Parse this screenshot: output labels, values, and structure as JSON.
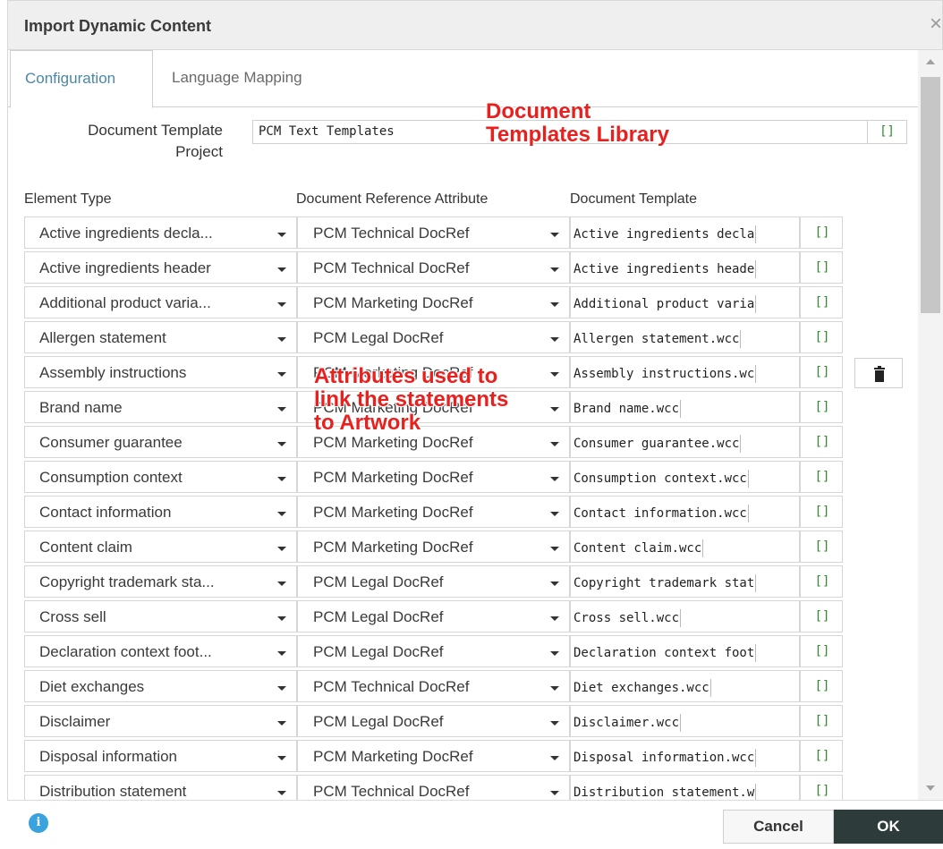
{
  "window": {
    "title": "Import Dynamic Content",
    "close_glyph": "×"
  },
  "tabs": [
    {
      "label": "Configuration",
      "active": true
    },
    {
      "label": "Language Mapping",
      "active": false
    }
  ],
  "project": {
    "label_line1": "Document Template",
    "label_line2": "Project",
    "value": "PCM Text Templates",
    "picker": "[]"
  },
  "columns": {
    "element_type": "Element Type",
    "reference_attribute": "Document Reference Attribute",
    "template": "Document Template"
  },
  "rows": [
    {
      "element": "Active ingredients decla...",
      "attribute": "PCM Technical DocRef",
      "template": "Active ingredients decla",
      "picker": "[]"
    },
    {
      "element": "Active ingredients header",
      "attribute": "PCM Technical DocRef",
      "template": "Active ingredients heade",
      "picker": "[]"
    },
    {
      "element": "Additional product varia...",
      "attribute": "PCM Marketing DocRef",
      "template": "Additional product varia",
      "picker": "[]"
    },
    {
      "element": "Allergen statement",
      "attribute": "PCM Legal DocRef",
      "template": "Allergen statement.wcc",
      "picker": "[]"
    },
    {
      "element": "Assembly instructions",
      "attribute": "PCM Marketing DocRef",
      "template": "Assembly instructions.wc",
      "picker": "[]"
    },
    {
      "element": "Brand name",
      "attribute": "PCM Marketing DocRef",
      "template": "Brand name.wcc",
      "picker": "[]"
    },
    {
      "element": "Consumer guarantee",
      "attribute": "PCM Marketing DocRef",
      "template": "Consumer guarantee.wcc",
      "picker": "[]"
    },
    {
      "element": "Consumption context",
      "attribute": "PCM Marketing DocRef",
      "template": "Consumption context.wcc",
      "picker": "[]"
    },
    {
      "element": "Contact information",
      "attribute": "PCM Marketing DocRef",
      "template": "Contact information.wcc",
      "picker": "[]"
    },
    {
      "element": "Content claim",
      "attribute": "PCM Marketing DocRef",
      "template": "Content claim.wcc",
      "picker": "[]"
    },
    {
      "element": "Copyright trademark sta...",
      "attribute": "PCM Legal DocRef",
      "template": "Copyright trademark stat",
      "picker": "[]"
    },
    {
      "element": "Cross sell",
      "attribute": "PCM Legal DocRef",
      "template": "Cross sell.wcc",
      "picker": "[]"
    },
    {
      "element": "Declaration context foot...",
      "attribute": "PCM Legal DocRef",
      "template": "Declaration context foot",
      "picker": "[]"
    },
    {
      "element": "Diet exchanges",
      "attribute": "PCM Technical DocRef",
      "template": "Diet exchanges.wcc",
      "picker": "[]"
    },
    {
      "element": "Disclaimer",
      "attribute": "PCM Legal DocRef",
      "template": "Disclaimer.wcc",
      "picker": "[]"
    },
    {
      "element": "Disposal information",
      "attribute": "PCM Marketing DocRef",
      "template": "Disposal information.wcc",
      "picker": "[]"
    },
    {
      "element": "Distribution statement",
      "attribute": "PCM Technical DocRef",
      "template": "Distribution statement.w",
      "picker": "[]"
    }
  ],
  "annotations": {
    "library_line1": "Document",
    "library_line2": "Templates Library",
    "attributes_line1": "Attributes used to",
    "attributes_line2": "link the statements",
    "attributes_line3": "to Artwork"
  },
  "footer": {
    "cancel_label": "Cancel",
    "ok_label": "OK",
    "info_glyph": "i"
  },
  "icons": {
    "info": "info-icon",
    "delete": "trash-icon",
    "close": "close-icon",
    "dropdown": "chevron-down-icon"
  },
  "colors": {
    "accent_tab": "#4a88a5",
    "picker_green": "#2e8b2e",
    "ok_button": "#2d3b3b",
    "annotation_red": "#e8201e",
    "info_blue": "#3aa2dd"
  }
}
